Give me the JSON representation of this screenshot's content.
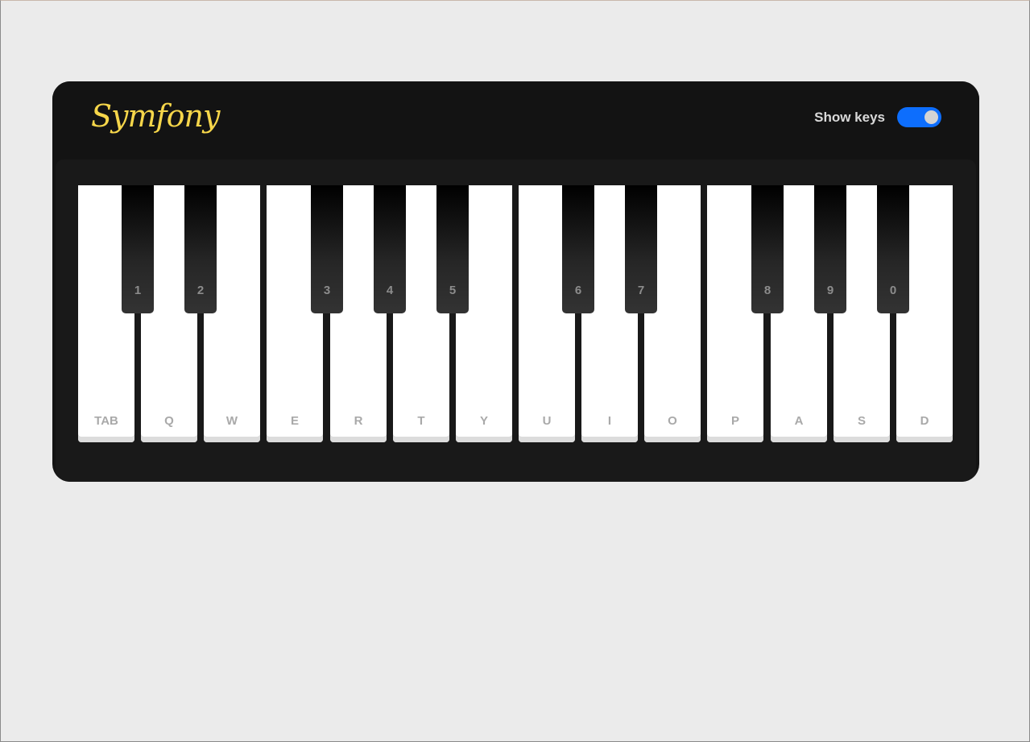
{
  "header": {
    "logo": "Symfony",
    "show_keys_label": "Show keys",
    "show_keys_enabled": true
  },
  "colors": {
    "page_background": "#ebebeb",
    "panel_background": "#141414",
    "logo": "#f6d64a",
    "toggle_on": "#0d6efd"
  },
  "white_keys": [
    "TAB",
    "Q",
    "W",
    "E",
    "R",
    "T",
    "Y",
    "U",
    "I",
    "O",
    "P",
    "A",
    "S",
    "D"
  ],
  "black_keys": [
    "1",
    "2",
    "3",
    "4",
    "5",
    "6",
    "7",
    "8",
    "9",
    "0"
  ]
}
